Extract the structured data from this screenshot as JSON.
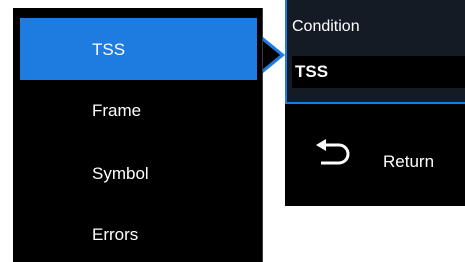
{
  "menu": {
    "items": [
      {
        "label": "TSS",
        "selected": true
      },
      {
        "label": "Frame",
        "selected": false
      },
      {
        "label": "Symbol",
        "selected": false
      },
      {
        "label": "Errors",
        "selected": false
      }
    ]
  },
  "panel": {
    "condition_label": "Condition",
    "condition_value": "TSS",
    "return_label": "Return",
    "return_icon": "return-arrow-icon"
  },
  "colors": {
    "accent": "#1e7be0",
    "background": "#000000",
    "text": "#ffffff"
  }
}
